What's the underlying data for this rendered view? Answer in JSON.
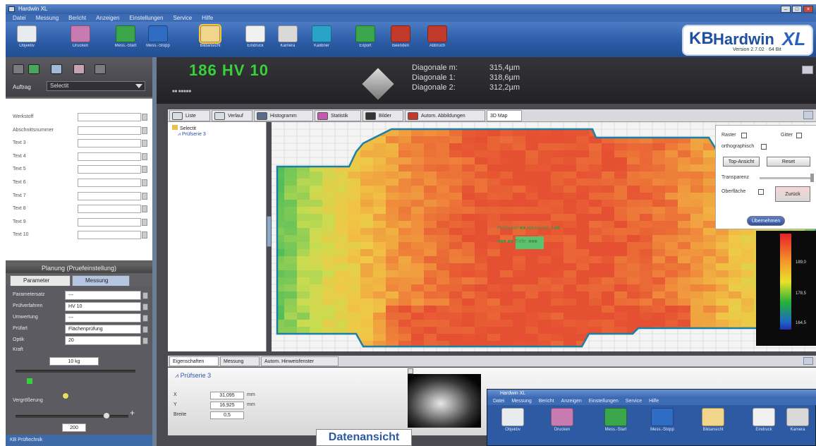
{
  "window": {
    "title": "Hardwin XL"
  },
  "menu": [
    "Datei",
    "Messung",
    "Bericht",
    "Anzeigen",
    "Einstellungen",
    "Service",
    "Hilfe"
  ],
  "toolbar": [
    {
      "label": "Objektiv",
      "icon": "microscope-icon",
      "color": "#e9ecef"
    },
    {
      "label": "Drucken",
      "icon": "printer-icon",
      "color": "#c77bb0"
    },
    {
      "label": "Mess.-Start",
      "icon": "start-icon",
      "color": "#3aa54a"
    },
    {
      "label": "Mess.-Stopp",
      "icon": "globe-icon",
      "color": "#2f6dc4"
    },
    {
      "label": "Bildansicht",
      "icon": "image-view-icon",
      "color": "#f1d58a"
    },
    {
      "label": "Eindruck",
      "icon": "indent-icon",
      "color": "#f0f0f0"
    },
    {
      "label": "Kamera",
      "icon": "camera-icon",
      "color": "#d9d9d9"
    },
    {
      "label": "Kalibrier",
      "icon": "calibrate-icon",
      "color": "#2aa3c9"
    },
    {
      "label": "Export",
      "icon": "export-icon",
      "color": "#3aa54a"
    },
    {
      "label": "Beenden",
      "icon": "exit-icon",
      "color": "#c0392b"
    },
    {
      "label": "Abbruch",
      "icon": "abort-icon",
      "color": "#c0392b"
    }
  ],
  "logo": {
    "kb": "KB",
    "name": "Hardwin",
    "xl": "XL",
    "version": "Version 2.7.02 · 64 Bit"
  },
  "left": {
    "auftrag_label": "Auftrag",
    "auftrag_value": "Selectit",
    "fields": [
      "Werkstoff",
      "Abschnittsnummer",
      "Text 3",
      "Text 4",
      "Text 5",
      "Text 6",
      "Text 7",
      "Text 8",
      "Text 9",
      "Text 10"
    ],
    "planung_title": "Planung (Pruefeinstellung)",
    "tabs": [
      "Parameter",
      "Messung"
    ],
    "rows": [
      {
        "label": "Parametersatz",
        "value": "---"
      },
      {
        "label": "Prüfverfahren",
        "value": "HV 10"
      },
      {
        "label": "Umwertung",
        "value": "---"
      },
      {
        "label": "Prüfart",
        "value": "Flächenprüfung"
      },
      {
        "label": "Optik",
        "value": "20"
      }
    ],
    "kraft_label": "Kraft",
    "kraft_value": "10 kg",
    "vergr_label": "Vergrößerung",
    "vergr_value": "200",
    "status": "KB Prüftechnik"
  },
  "result": {
    "hv": "186 HV 10",
    "sub": "■■ ■■■■■",
    "diag_labels": [
      "Diagonale m:",
      "Diagonale 1:",
      "Diagonale 2:"
    ],
    "diag_values": [
      "315,4µm",
      "318,6µm",
      "312,2µm"
    ]
  },
  "tabs": [
    "Liste",
    "Verlauf",
    "Histogramm",
    "Statistik",
    "Bilder",
    "Autom. Abbildungen",
    "3D Map"
  ],
  "tree": {
    "root": "Selectit",
    "child": "Prüfserie 3"
  },
  "map_annotation": {
    "line1": "Prüfpunkt ■■ Härtewert: 1■■",
    "line2": "■■■ ■■ Tiefe: ■■■"
  },
  "controls": {
    "raster": "Raster",
    "gitter": "Gitter",
    "orthographisch": "orthographisch",
    "topview": "Top-Ansicht",
    "reset": "Reset",
    "transparenz": "Transparenz",
    "oberflaeche": "Oberfläche",
    "zuruecksetzen": "Zurück",
    "apply": "Übernehmen"
  },
  "scale_values": [
    "189,0",
    "178,5",
    "164,5"
  ],
  "bottom_tabs": [
    "Eigenschaften",
    "Messung",
    "Autom. Hinweisfenster"
  ],
  "bottom": {
    "link": "Prüfserie 3",
    "coords": [
      {
        "k": "X",
        "v": "31,095",
        "u": "mm"
      },
      {
        "k": "Y",
        "v": "16,925",
        "u": "mm"
      },
      {
        "k": "Breite",
        "v": "0,5",
        "u": ""
      }
    ]
  },
  "datenansicht": "Datenansicht",
  "mini": {
    "title": "Hardwin XL",
    "menu": [
      "Datei",
      "Messung",
      "Bericht",
      "Anzeigen",
      "Einstellungen",
      "Service",
      "Hilfe"
    ],
    "toolbar": [
      {
        "label": "Objektiv",
        "icon": "microscope-icon",
        "color": "#e9ecef"
      },
      {
        "label": "Drucken",
        "icon": "printer-icon",
        "color": "#c77bb0"
      },
      {
        "label": "Mess.-Start",
        "icon": "start-icon",
        "color": "#3aa54a"
      },
      {
        "label": "Mess.-Stopp",
        "icon": "globe-icon",
        "color": "#2f6dc4"
      },
      {
        "label": "Bildansicht",
        "icon": "image-view-icon",
        "color": "#f1d58a"
      },
      {
        "label": "Eindruck",
        "icon": "indent-icon",
        "color": "#f0f0f0"
      },
      {
        "label": "Kamera",
        "icon": "camera-icon",
        "color": "#d9d9d9"
      }
    ]
  }
}
